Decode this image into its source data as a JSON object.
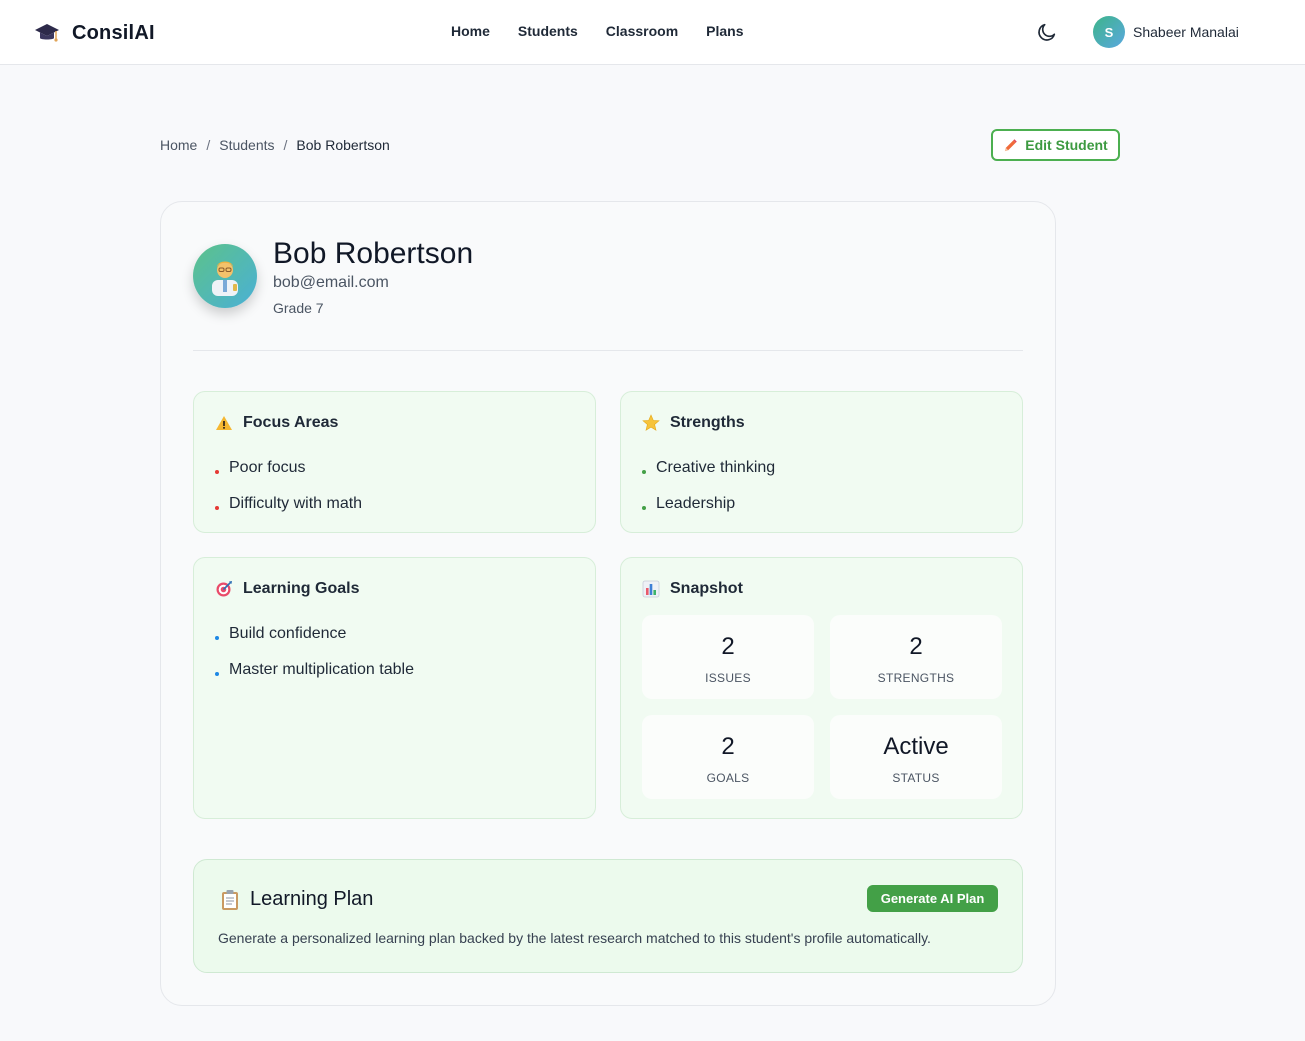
{
  "app": {
    "name": "ConsilAI"
  },
  "nav": {
    "links": [
      "Home",
      "Students",
      "Classroom",
      "Plans"
    ],
    "user": {
      "initial": "S",
      "name": "Shabeer Manalai"
    }
  },
  "breadcrumb": {
    "items": [
      "Home",
      "Students"
    ],
    "current": "Bob Robertson",
    "separator": "/"
  },
  "actions": {
    "edit_label": "Edit Student"
  },
  "student": {
    "name": "Bob Robertson",
    "email": "bob@email.com",
    "grade": "Grade 7"
  },
  "focus_areas": {
    "title": "Focus Areas",
    "icon": "warning-icon",
    "items": [
      "Poor focus",
      "Difficulty with math"
    ],
    "dot_color": "#e53935"
  },
  "strengths": {
    "title": "Strengths",
    "icon": "star-icon",
    "items": [
      "Creative thinking",
      "Leadership"
    ],
    "dot_color": "#43a047"
  },
  "learning_goals": {
    "title": "Learning Goals",
    "icon": "target-icon",
    "items": [
      "Build confidence",
      "Master multiplication table"
    ],
    "dot_color": "#1e88e5"
  },
  "snapshot": {
    "title": "Snapshot",
    "icon": "bar-chart-icon",
    "stats": [
      {
        "value": "2",
        "label": "ISSUES"
      },
      {
        "value": "2",
        "label": "STRENGTHS"
      },
      {
        "value": "2",
        "label": "GOALS"
      },
      {
        "value": "Active",
        "label": "STATUS"
      }
    ]
  },
  "learning_plan": {
    "title": "Learning Plan",
    "icon": "clipboard-icon",
    "button_label": "Generate AI Plan",
    "description": "Generate a personalized learning plan backed by the latest research matched to this student's profile automatically."
  },
  "colors": {
    "accent": "#4caf50",
    "button_green": "#43a047"
  }
}
